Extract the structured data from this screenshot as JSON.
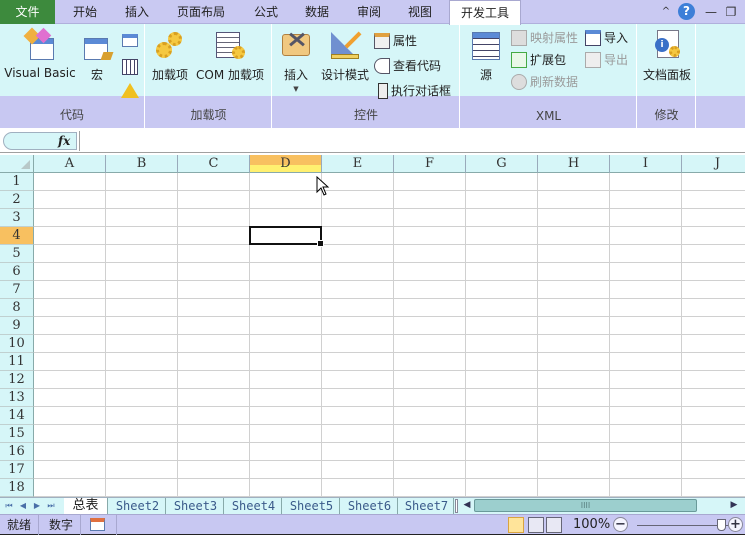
{
  "menubar": {
    "tabs": [
      {
        "label": "文件"
      },
      {
        "label": "开始"
      },
      {
        "label": "插入"
      },
      {
        "label": "页面布局"
      },
      {
        "label": "公式"
      },
      {
        "label": "数据"
      },
      {
        "label": "审阅"
      },
      {
        "label": "视图"
      },
      {
        "label": "开发工具",
        "active": true
      }
    ],
    "window_controls": {
      "collapse": "^",
      "help": "?",
      "minimize": "—",
      "restore": "❐"
    }
  },
  "ribbon": {
    "groups": [
      {
        "label": "代码",
        "buttons": {
          "visual_basic": "Visual Basic",
          "macro": "宏"
        }
      },
      {
        "label": "加载项",
        "buttons": {
          "addins": "加载项",
          "com_addins": "COM 加载项"
        }
      },
      {
        "label": "控件",
        "buttons": {
          "insert": "插入",
          "design_mode": "设计模式",
          "properties": "属性",
          "view_code": "查看代码",
          "run_dialog": "执行对话框"
        }
      },
      {
        "label": "XML",
        "buttons": {
          "source": "源",
          "map_properties": "映射属性",
          "expansion_packs": "扩展包",
          "refresh_data": "刷新数据",
          "import": "导入",
          "export": "导出"
        }
      },
      {
        "label": "修改",
        "buttons": {
          "document_panel": "文档面板"
        }
      }
    ]
  },
  "formula_bar": {
    "name_box": "",
    "fx": "fx",
    "formula": ""
  },
  "grid": {
    "columns": [
      "A",
      "B",
      "C",
      "D",
      "E",
      "F",
      "G",
      "H",
      "I",
      "J"
    ],
    "rows": [
      "1",
      "2",
      "3",
      "4",
      "5",
      "6",
      "7",
      "8",
      "9",
      "10",
      "11",
      "12",
      "13",
      "14",
      "15",
      "16",
      "17",
      "18"
    ],
    "selected_cell": "D4",
    "selected_column": "D",
    "selected_row": "4"
  },
  "sheets": {
    "nav": [
      "⏮",
      "◀",
      "▶",
      "⏭"
    ],
    "tabs": [
      "总表",
      "Sheet2",
      "Sheet3",
      "Sheet4",
      "Sheet5",
      "Sheet6",
      "Sheet7"
    ],
    "active": "总表",
    "scroll_grip": "IIII"
  },
  "status": {
    "ready": "就绪",
    "mode": "数字",
    "zoom": "100%",
    "zoom_minus": "−",
    "zoom_plus": "+",
    "zoom_level_pct": 100
  },
  "colors": {
    "file_tab": "#3d8a3d",
    "menu_bg": "#c9c9f2",
    "ribbon_bg": "#d6f6f8",
    "selection_header": "#f8c060"
  }
}
